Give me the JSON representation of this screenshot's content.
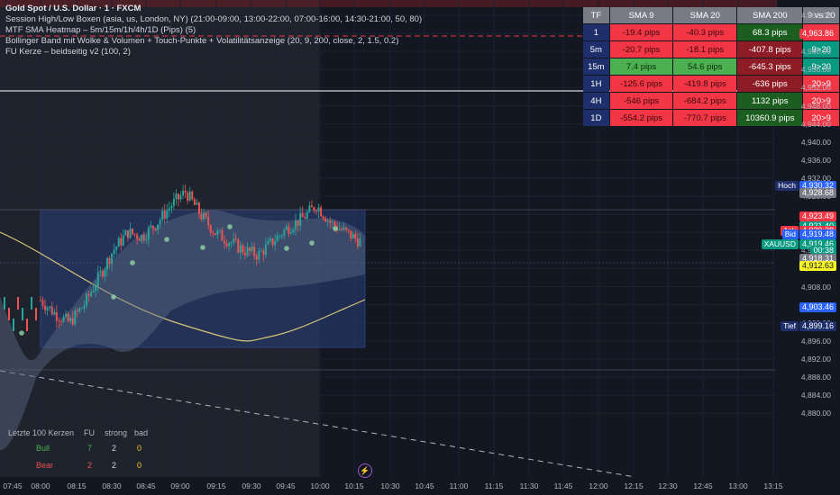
{
  "header": {
    "title": "Gold Spot / U.S. Dollar · 1 · FXCM",
    "indicators": [
      "Session High/Low Boxen (asia, us, London, NY) (21:00-09:00, 13:00-22:00, 07:00-16:00, 14:30-21:00, 50, 80)",
      "MTF SMA Heatmap – 5m/15m/1h/4h/1D (Pips) (5)",
      "Bollinger Band mit Wolke & Volumen + Touch-Punkte + Volatilitätsanzeige (20, 9, 200, close, 2, 1.5, 0.2)",
      "FU Kerze – beidseitig v2 (100, 2)"
    ]
  },
  "heatmap": {
    "headers": [
      "TF",
      "SMA 9",
      "SMA 20",
      "SMA 200",
      "9 vs 20"
    ],
    "rows": [
      {
        "tf": "1",
        "c": [
          {
            "t": "-19.4 pips",
            "k": "neg_light"
          },
          {
            "t": "-40.3 pips",
            "k": "neg_light"
          },
          {
            "t": "68.3 pips",
            "k": "pos_dark"
          },
          {
            "t": "20>9",
            "k": "red"
          }
        ]
      },
      {
        "tf": "5m",
        "c": [
          {
            "t": "-20.7 pips",
            "k": "neg_light"
          },
          {
            "t": "-18.1 pips",
            "k": "neg_light"
          },
          {
            "t": "-407.8 pips",
            "k": "neg_dark"
          },
          {
            "t": "9>20",
            "k": "green"
          }
        ]
      },
      {
        "tf": "15m",
        "c": [
          {
            "t": "7.4 pips",
            "k": "pos_light"
          },
          {
            "t": "54.6 pips",
            "k": "pos_light"
          },
          {
            "t": "-645.3 pips",
            "k": "neg_dark"
          },
          {
            "t": "9>20",
            "k": "green"
          }
        ]
      },
      {
        "tf": "1H",
        "c": [
          {
            "t": "-125.6 pips",
            "k": "neg_mid"
          },
          {
            "t": "-419.8 pips",
            "k": "neg_mid"
          },
          {
            "t": "-636 pips",
            "k": "neg_dark"
          },
          {
            "t": "20>9",
            "k": "red"
          }
        ]
      },
      {
        "tf": "4H",
        "c": [
          {
            "t": "-546 pips",
            "k": "neg_mid"
          },
          {
            "t": "-684.2 pips",
            "k": "neg_mid"
          },
          {
            "t": "1132 pips",
            "k": "pos_dark"
          },
          {
            "t": "20>9",
            "k": "red"
          }
        ]
      },
      {
        "tf": "1D",
        "c": [
          {
            "t": "-554.2 pips",
            "k": "neg_mid"
          },
          {
            "t": "-770.7 pips",
            "k": "neg_mid"
          },
          {
            "t": "10360.9 pips",
            "k": "pos_dark"
          },
          {
            "t": "20>9",
            "k": "red"
          }
        ]
      }
    ]
  },
  "stats": {
    "title": "Letzte 100 Kerzen",
    "cols": [
      "FU",
      "strong",
      "bad"
    ],
    "bull_label": "Bull",
    "bull": [
      "7",
      "2",
      "0"
    ],
    "bear_label": "Bear",
    "bear": [
      "2",
      "2",
      "0"
    ]
  },
  "price_axis": [
    "4,968.00",
    "4,964.00",
    "4,960.00",
    "4,956.00",
    "4,952.00",
    "4,948.00",
    "4,944.00",
    "4,940.00",
    "4,936.00",
    "4,932.00",
    "4,928.00",
    "4,924.00",
    "4,920.00",
    "4,916.00",
    "4,912.00",
    "4,908.00",
    "4,904.00",
    "4,900.00",
    "4,896.00",
    "4,892.00",
    "4,888.00",
    "4,884.00",
    "4,880.00"
  ],
  "price_tags": [
    {
      "text": "4,963.86",
      "price": 4963.86,
      "bg": "#f23645",
      "fg": "#ffffff"
    },
    {
      "text": "4,930.32",
      "price": 4930.32,
      "bg": "#2962ff",
      "fg": "#ffffff"
    },
    {
      "text": "4,928.68",
      "price": 4928.68,
      "bg": "#787b86",
      "fg": "#ffffff"
    },
    {
      "text": "4,923.49",
      "price": 4923.49,
      "bg": "#f23645",
      "fg": "#ffffff"
    },
    {
      "text": "4,921.40",
      "price": 4921.4,
      "bg": "#089981",
      "fg": "#ffffff"
    },
    {
      "text": "4,920.38",
      "price": 4920.38,
      "bg": "#f23645",
      "fg": "#ffffff"
    },
    {
      "text": "4,919.48",
      "price": 4919.48,
      "bg": "#2962ff",
      "fg": "#ffffff"
    },
    {
      "text": "4,919.46",
      "price": 4917.4,
      "bg": "#089981",
      "fg": "#ffffff"
    },
    {
      "text": "00:38",
      "price": 4915.9,
      "bg": "#089981",
      "fg": "#ffffff"
    },
    {
      "text": "4,918.31",
      "price": 4914.1,
      "bg": "#787b86",
      "fg": "#ffffff"
    },
    {
      "text": "4,912.63",
      "price": 4912.63,
      "bg": "#f7f525",
      "fg": "#131722"
    },
    {
      "text": "4,903.46",
      "price": 4903.46,
      "bg": "#2962ff",
      "fg": "#ffffff"
    },
    {
      "text": "4,899.16",
      "price": 4899.16,
      "bg": "#1e2f6b",
      "fg": "#ffffff"
    }
  ],
  "side_tags": [
    {
      "text": "Hoch",
      "price": 4930.32,
      "bg": "#1e2f6b"
    },
    {
      "text": "Ask",
      "price": 4920.38,
      "bg": "#f23645"
    },
    {
      "text": "Bid",
      "price": 4919.48,
      "bg": "#2962ff"
    },
    {
      "text": "XAUUSD",
      "price": 4917.4,
      "bg": "#089981"
    },
    {
      "text": "Tief",
      "price": 4899.16,
      "bg": "#1e2f6b"
    }
  ],
  "time_axis": [
    "07:45",
    "08:00",
    "08:15",
    "08:30",
    "08:45",
    "09:00",
    "09:15",
    "09:30",
    "09:45",
    "10:00",
    "10:15",
    "10:30",
    "10:45",
    "11:00",
    "11:15",
    "11:30",
    "11:45",
    "12:00",
    "12:15",
    "12:30",
    "12:45",
    "13:00",
    "13:15"
  ],
  "colors": {
    "background": "#131722",
    "up": "#26a69a",
    "down": "#ef5350",
    "sma200": "#d6c678",
    "box": "#2a3f7a",
    "neg_light": "#f23645",
    "neg_mid": "#f23645",
    "neg_dark": "#8e1c26",
    "pos_light": "#4caf50",
    "pos_dark": "#1b5e20",
    "red": "#f23645",
    "green": "#089981"
  },
  "icons": {
    "bolt": "lightning-icon"
  }
}
